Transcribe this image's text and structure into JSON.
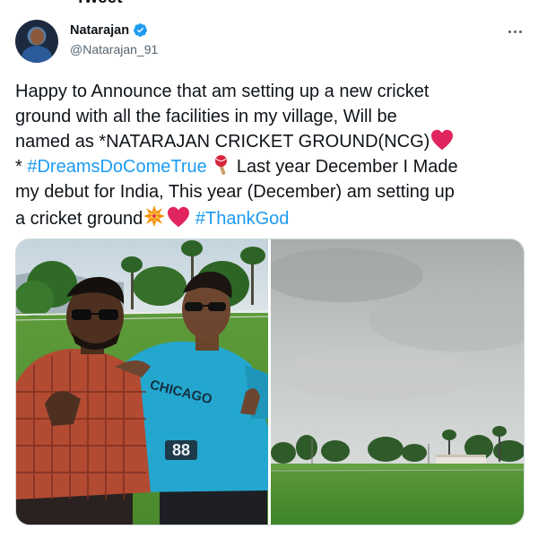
{
  "header_clip": "Tweet",
  "author": {
    "name": "Natarajan",
    "handle": "@Natarajan_91",
    "verified": true,
    "avatar_icon": "profile-photo"
  },
  "more_icon": "ellipsis-icon",
  "tweet": {
    "line1": "Happy to Announce that am setting up a new cricket",
    "line2": "ground with all the facilities in my village, Will be",
    "line3": "named as *NATARAJAN CRICKET GROUND(NCG)",
    "line4_prefix": "* ",
    "hashtag1": "#DreamsDoComeTrue",
    "line4_after_bat": " Last year December I Made",
    "line5": "my debut for India, This year (December) am setting up",
    "line6": "a cricket ground",
    "hashtag2": "#ThankGod"
  },
  "emoji": {
    "heart": "red-heart-icon",
    "bat": "cricket-bat-ball-icon",
    "collision": "collision-icon"
  },
  "media": {
    "left_photo_label": "two-men-photo",
    "right_photo_label": "cricket-ground-photo",
    "shirt_text": "CHICAGO",
    "shirt_number": "88"
  },
  "colors": {
    "link": "#1d9bf0",
    "verified": "#1d9bf0",
    "heart": "#e0245e",
    "secondary_text": "#536471"
  }
}
